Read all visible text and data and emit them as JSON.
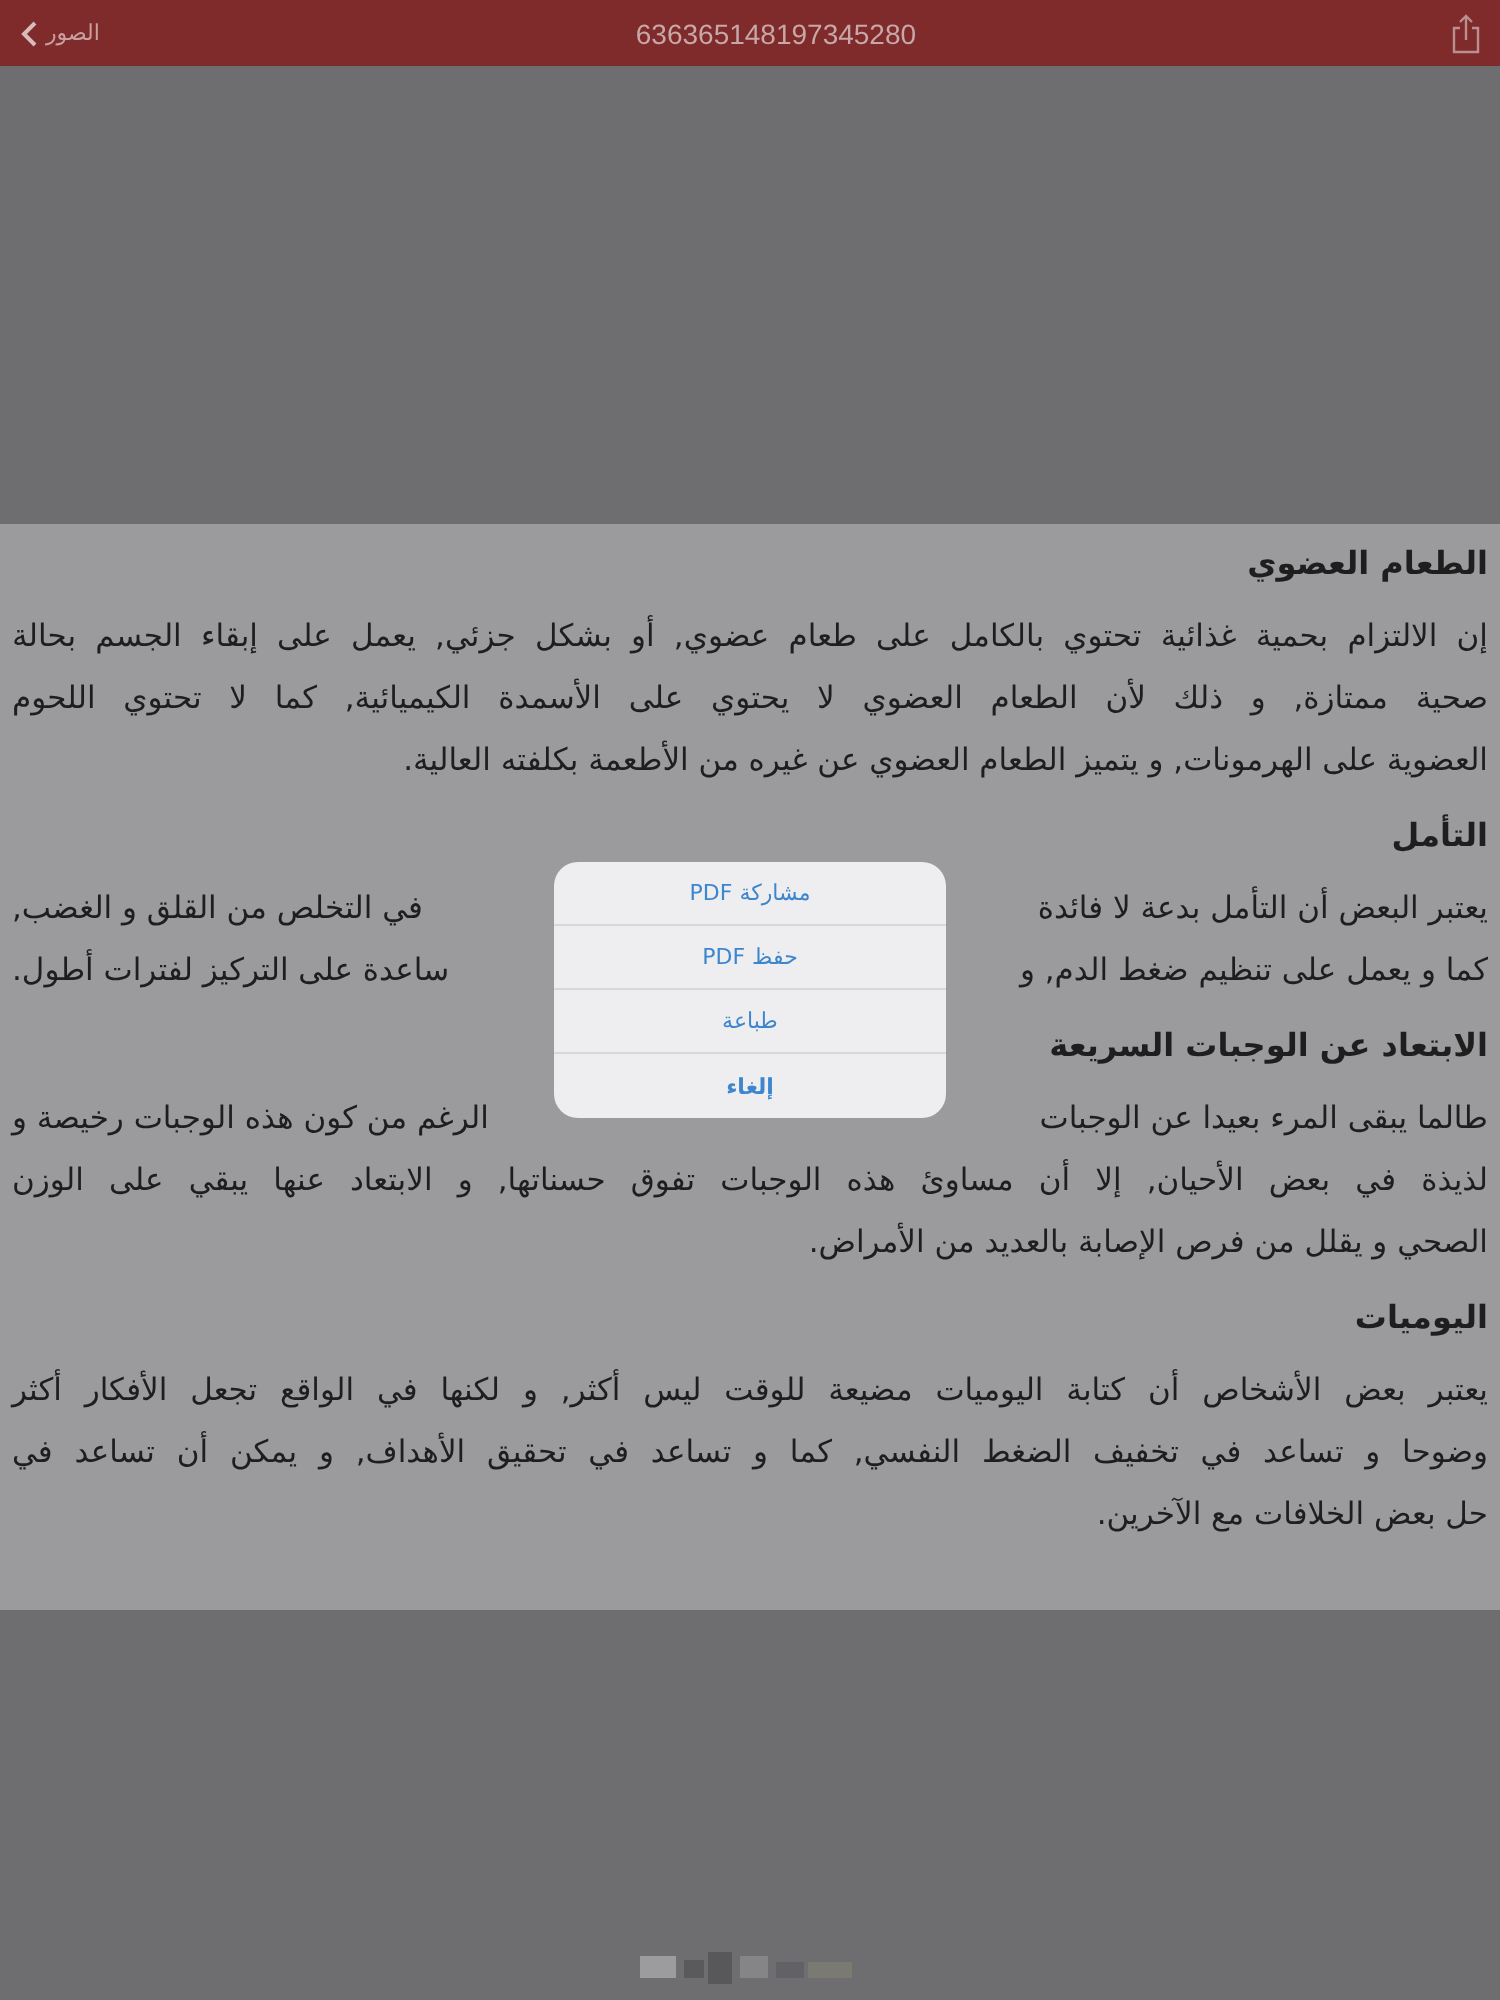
{
  "nav_bar": {
    "back_label": "الصور",
    "title": "636365148197345280"
  },
  "document": {
    "sections": [
      {
        "heading": "الطعام العضوي",
        "lines": [
          {
            "kind": "full",
            "text": "إن الالتزام بحمية غذائية تحتوي بالكامل على طعام عضوي, أو بشكل جزئي, يعمل على إبقاء الجسم بحالة"
          },
          {
            "kind": "full",
            "text": "صحية ممتازة, و ذلك لأن الطعام العضوي لا يحتوي على الأسمدة الكيميائية,  كما لا تحتوي اللحوم"
          },
          {
            "kind": "last",
            "text": "العضوية على الهرمونات, و يتميز الطعام العضوي عن غيره من الأطعمة بكلفته العالية."
          }
        ]
      },
      {
        "heading": "التأمل",
        "lines": [
          {
            "kind": "split",
            "right": "يعتبر البعض أن التأمل بدعة لا فائدة",
            "left": "في التخلص من القلق و الغضب,"
          },
          {
            "kind": "split",
            "right": "كما و يعمل على تنظيم ضغط الدم, و",
            "left": "ساعدة على التركيز لفترات أطول."
          }
        ]
      },
      {
        "heading": "الابتعاد عن الوجبات السريعة",
        "lines": [
          {
            "kind": "split",
            "right": "طالما يبقى المرء بعيدا عن الوجبات",
            "left": "الرغم من كون هذه الوجبات رخيصة و"
          },
          {
            "kind": "full",
            "text": "لذيذة في بعض الأحيان, إلا أن مساوئ هذه الوجبات تفوق حسناتها, و الابتعاد عنها يبقي على الوزن"
          },
          {
            "kind": "last",
            "text": "الصحي و يقلل من فرص الإصابة بالعديد من الأمراض."
          }
        ]
      },
      {
        "heading": "اليوميات",
        "lines": [
          {
            "kind": "full",
            "text": "يعتبر بعض الأشخاص أن كتابة اليوميات مضيعة للوقت ليس أكثر, و لكنها في الواقع  تجعل الأفكار أكثر"
          },
          {
            "kind": "full",
            "text": "وضوحا و تساعد في تخفيف الضغط النفسي,  كما و تساعد في تحقيق الأهداف, و يمكن أن تساعد في"
          },
          {
            "kind": "last",
            "text": "حل بعض الخلافات مع الآخرين."
          }
        ]
      }
    ]
  },
  "action_menu": {
    "items": [
      {
        "label": "مشاركة PDF",
        "kind": "action"
      },
      {
        "label": "حفظ PDF",
        "kind": "action"
      },
      {
        "label": "طباعة",
        "kind": "action"
      },
      {
        "label": "إلغاء",
        "kind": "cancel"
      }
    ]
  }
}
